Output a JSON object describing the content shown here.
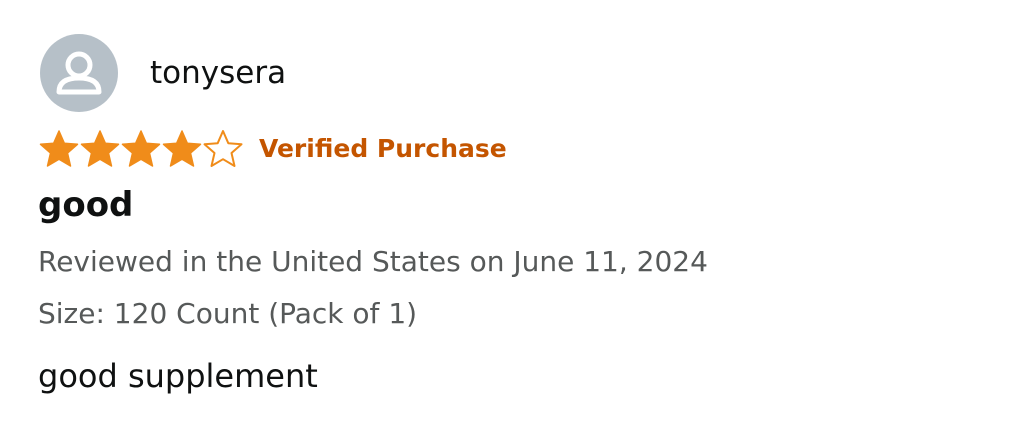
{
  "review": {
    "user": {
      "name": "tonysera",
      "avatar_icon": "default-user-avatar-icon"
    },
    "rating": {
      "stars": 4,
      "max": 5
    },
    "verified_label": "Verified Purchase",
    "title": "good",
    "reviewed_line": "Reviewed in the United States on June 11, 2024",
    "size_line": "Size: 120 Count (Pack of 1)",
    "body": "good supplement"
  },
  "colors": {
    "star_fill": "#f08c1a",
    "star_outline": "#f08c1a",
    "verified": "#c45500",
    "avatar_bg": "#b6c0c8",
    "meta_text": "#565959",
    "primary_text": "#0f1111"
  }
}
